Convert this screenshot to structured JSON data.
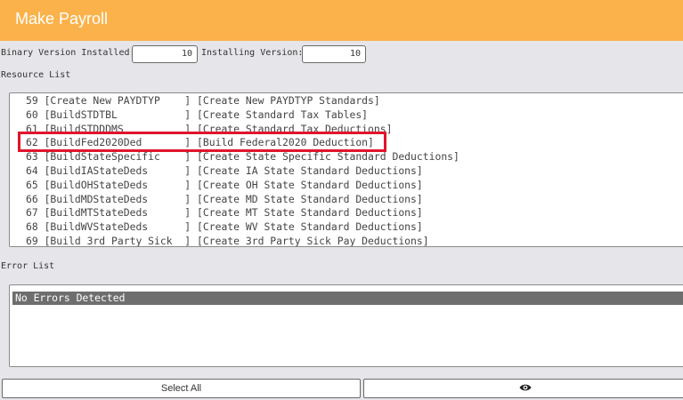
{
  "window": {
    "title": "Make Payroll"
  },
  "versions": {
    "binary_label": "Binary Version Installed:",
    "binary_value": "10",
    "installing_label": "Installing Version:",
    "installing_value": "10"
  },
  "resource_list": {
    "label": "Resource List",
    "rows": [
      "59 [Create New PAYDTYP    ] [Create New PAYDTYP Standards]",
      "60 [BuildSTDTBL           ] [Create Standard Tax Tables]",
      "61 [BuildSTDDDMS          ] [Create Standard Tax Deductions]",
      "62 [BuildFed2020Ded       ] [Build Federal2020 Deduction]",
      "63 [BuildStateSpecific    ] [Create State Specific Standard Deductions]",
      "64 [BuildIAStateDeds      ] [Create IA State Standard Deductions]",
      "65 [BuildOHStateDeds      ] [Create OH State Standard Deductions]",
      "66 [BuildMDStateDeds      ] [Create MD State Standard Deductions]",
      "67 [BuildMTStateDeds      ] [Create MT State Standard Deductions]",
      "68 [BuildWVStateDeds      ] [Create WV State Standard Deductions]",
      "69 [Build 3rd Party Sick  ] [Create 3rd Party Sick Pay Deductions]"
    ]
  },
  "error_list": {
    "label": "Error List",
    "rows": [
      "No Errors Detected"
    ]
  },
  "buttons": {
    "select_all": "Select All",
    "view_icon": "eye-icon"
  },
  "colors": {
    "titlebar": "#fbb24a",
    "highlight": "#e0152b",
    "selected_row": "#6e6e6e"
  }
}
